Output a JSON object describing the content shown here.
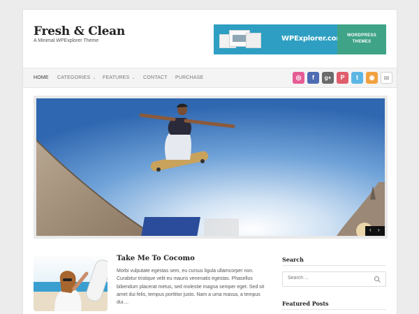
{
  "site": {
    "title": "Fresh & Clean",
    "tagline": "A Minimal WPExplorer Theme"
  },
  "banner": {
    "brand": "WPExplorer.com",
    "side_line1": "WORDPRESS",
    "side_line2": "THEMES"
  },
  "nav": {
    "items": [
      {
        "label": "HOME",
        "active": true
      },
      {
        "label": "CATEGORIES",
        "dropdown": true
      },
      {
        "label": "FEATURES",
        "dropdown": true
      },
      {
        "label": "CONTACT"
      },
      {
        "label": "PURCHASE"
      }
    ],
    "caret": "⌄"
  },
  "social": [
    {
      "icon": "dribbble-icon",
      "glyph": "◎",
      "color": "#e65c94"
    },
    {
      "icon": "facebook-icon",
      "glyph": "f",
      "color": "#4d6cb3"
    },
    {
      "icon": "google-plus-icon",
      "glyph": "g+",
      "color": "#6a6a6a"
    },
    {
      "icon": "pinterest-icon",
      "glyph": "P",
      "color": "#e05d6c"
    },
    {
      "icon": "twitter-icon",
      "glyph": "t",
      "color": "#5cb6e4"
    },
    {
      "icon": "rss-icon",
      "glyph": "◉",
      "color": "#f2a13f"
    },
    {
      "icon": "mail-icon",
      "glyph": "✉",
      "color": "#d6d6d6"
    }
  ],
  "slider": {
    "prev": "‹",
    "next": "›"
  },
  "post": {
    "title": "Take Me To Cocomo",
    "excerpt": "Morbi vulputate egestas sem, eu cursus ligula ullamcorper non. Curabitur tristique velit eu mauris venenatis egestas. Phasellus bibendum placerat metus, sed molestie magna semper eget. Sed sit amet dui felis, tempus porttitor justo. Nam a uma massa, a tempus dui...."
  },
  "sidebar": {
    "search_heading": "Search",
    "search_placeholder": "Search ...",
    "featured_heading": "Featured Posts"
  },
  "colors": {
    "banner_blue": "#2e9fc2",
    "banner_green": "#3fa387"
  }
}
